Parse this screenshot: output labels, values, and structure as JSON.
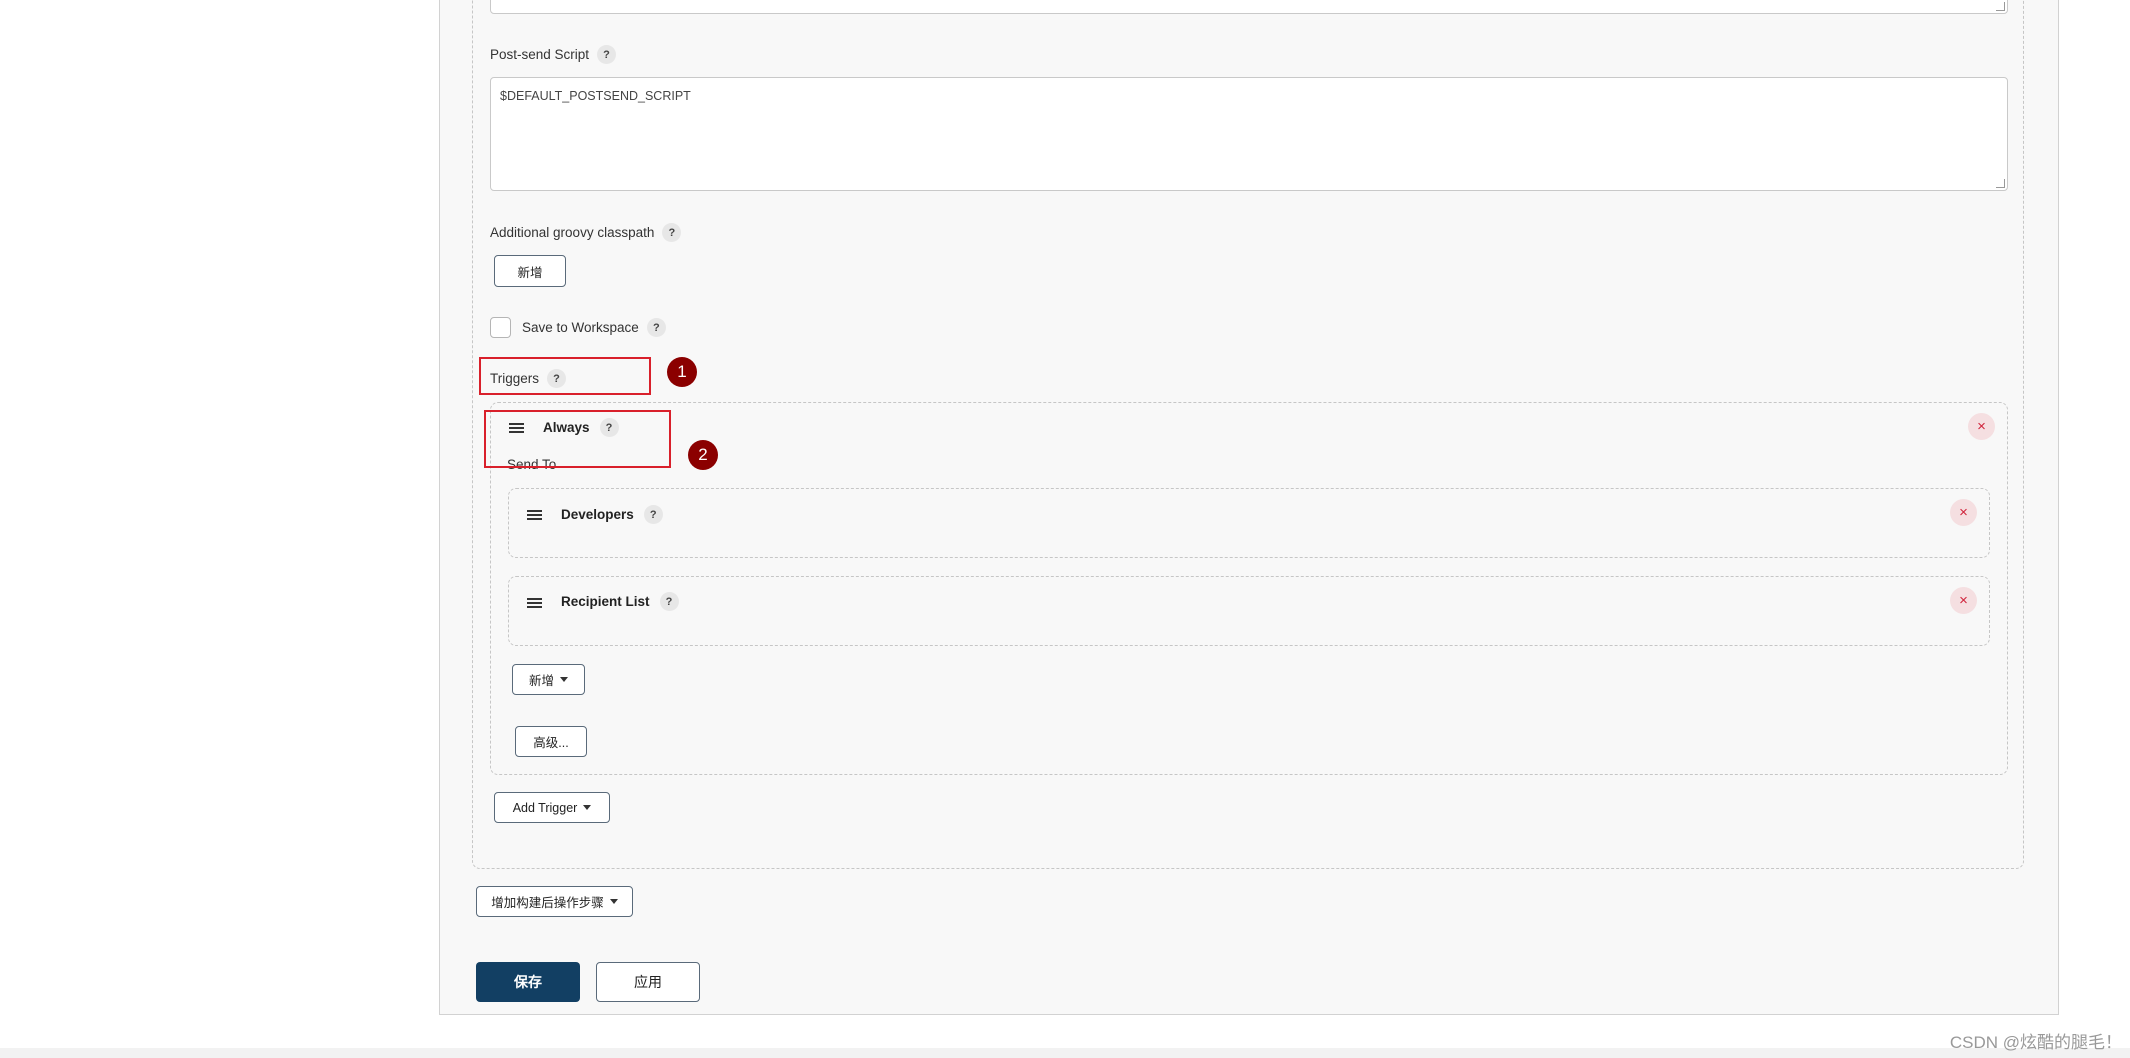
{
  "post_send": {
    "label": "Post-send Script",
    "help": "?",
    "value": "$DEFAULT_POSTSEND_SCRIPT"
  },
  "groovy": {
    "label": "Additional groovy classpath",
    "help": "?",
    "add_label": "新增"
  },
  "workspace": {
    "label": "Save to Workspace",
    "help": "?",
    "checked": false
  },
  "triggers": {
    "label": "Triggers",
    "help": "?",
    "always": {
      "title": "Always",
      "help": "?",
      "remove": "×",
      "send_to_label": "Send To",
      "recipients": [
        {
          "title": "Developers",
          "help": "?",
          "remove": "×"
        },
        {
          "title": "Recipient List",
          "help": "?",
          "remove": "×"
        }
      ],
      "add_label": "新增",
      "advanced_label": "高级..."
    },
    "add_trigger_label": "Add Trigger"
  },
  "post_build": {
    "add_step_label": "增加构建后操作步骤"
  },
  "actions": {
    "save_label": "保存",
    "apply_label": "应用"
  },
  "annotations": {
    "badge1": "1",
    "badge2": "2",
    "color": "#d9202b",
    "badge_color": "#8b0000"
  },
  "watermark": "CSDN @炫酷的腿毛！"
}
